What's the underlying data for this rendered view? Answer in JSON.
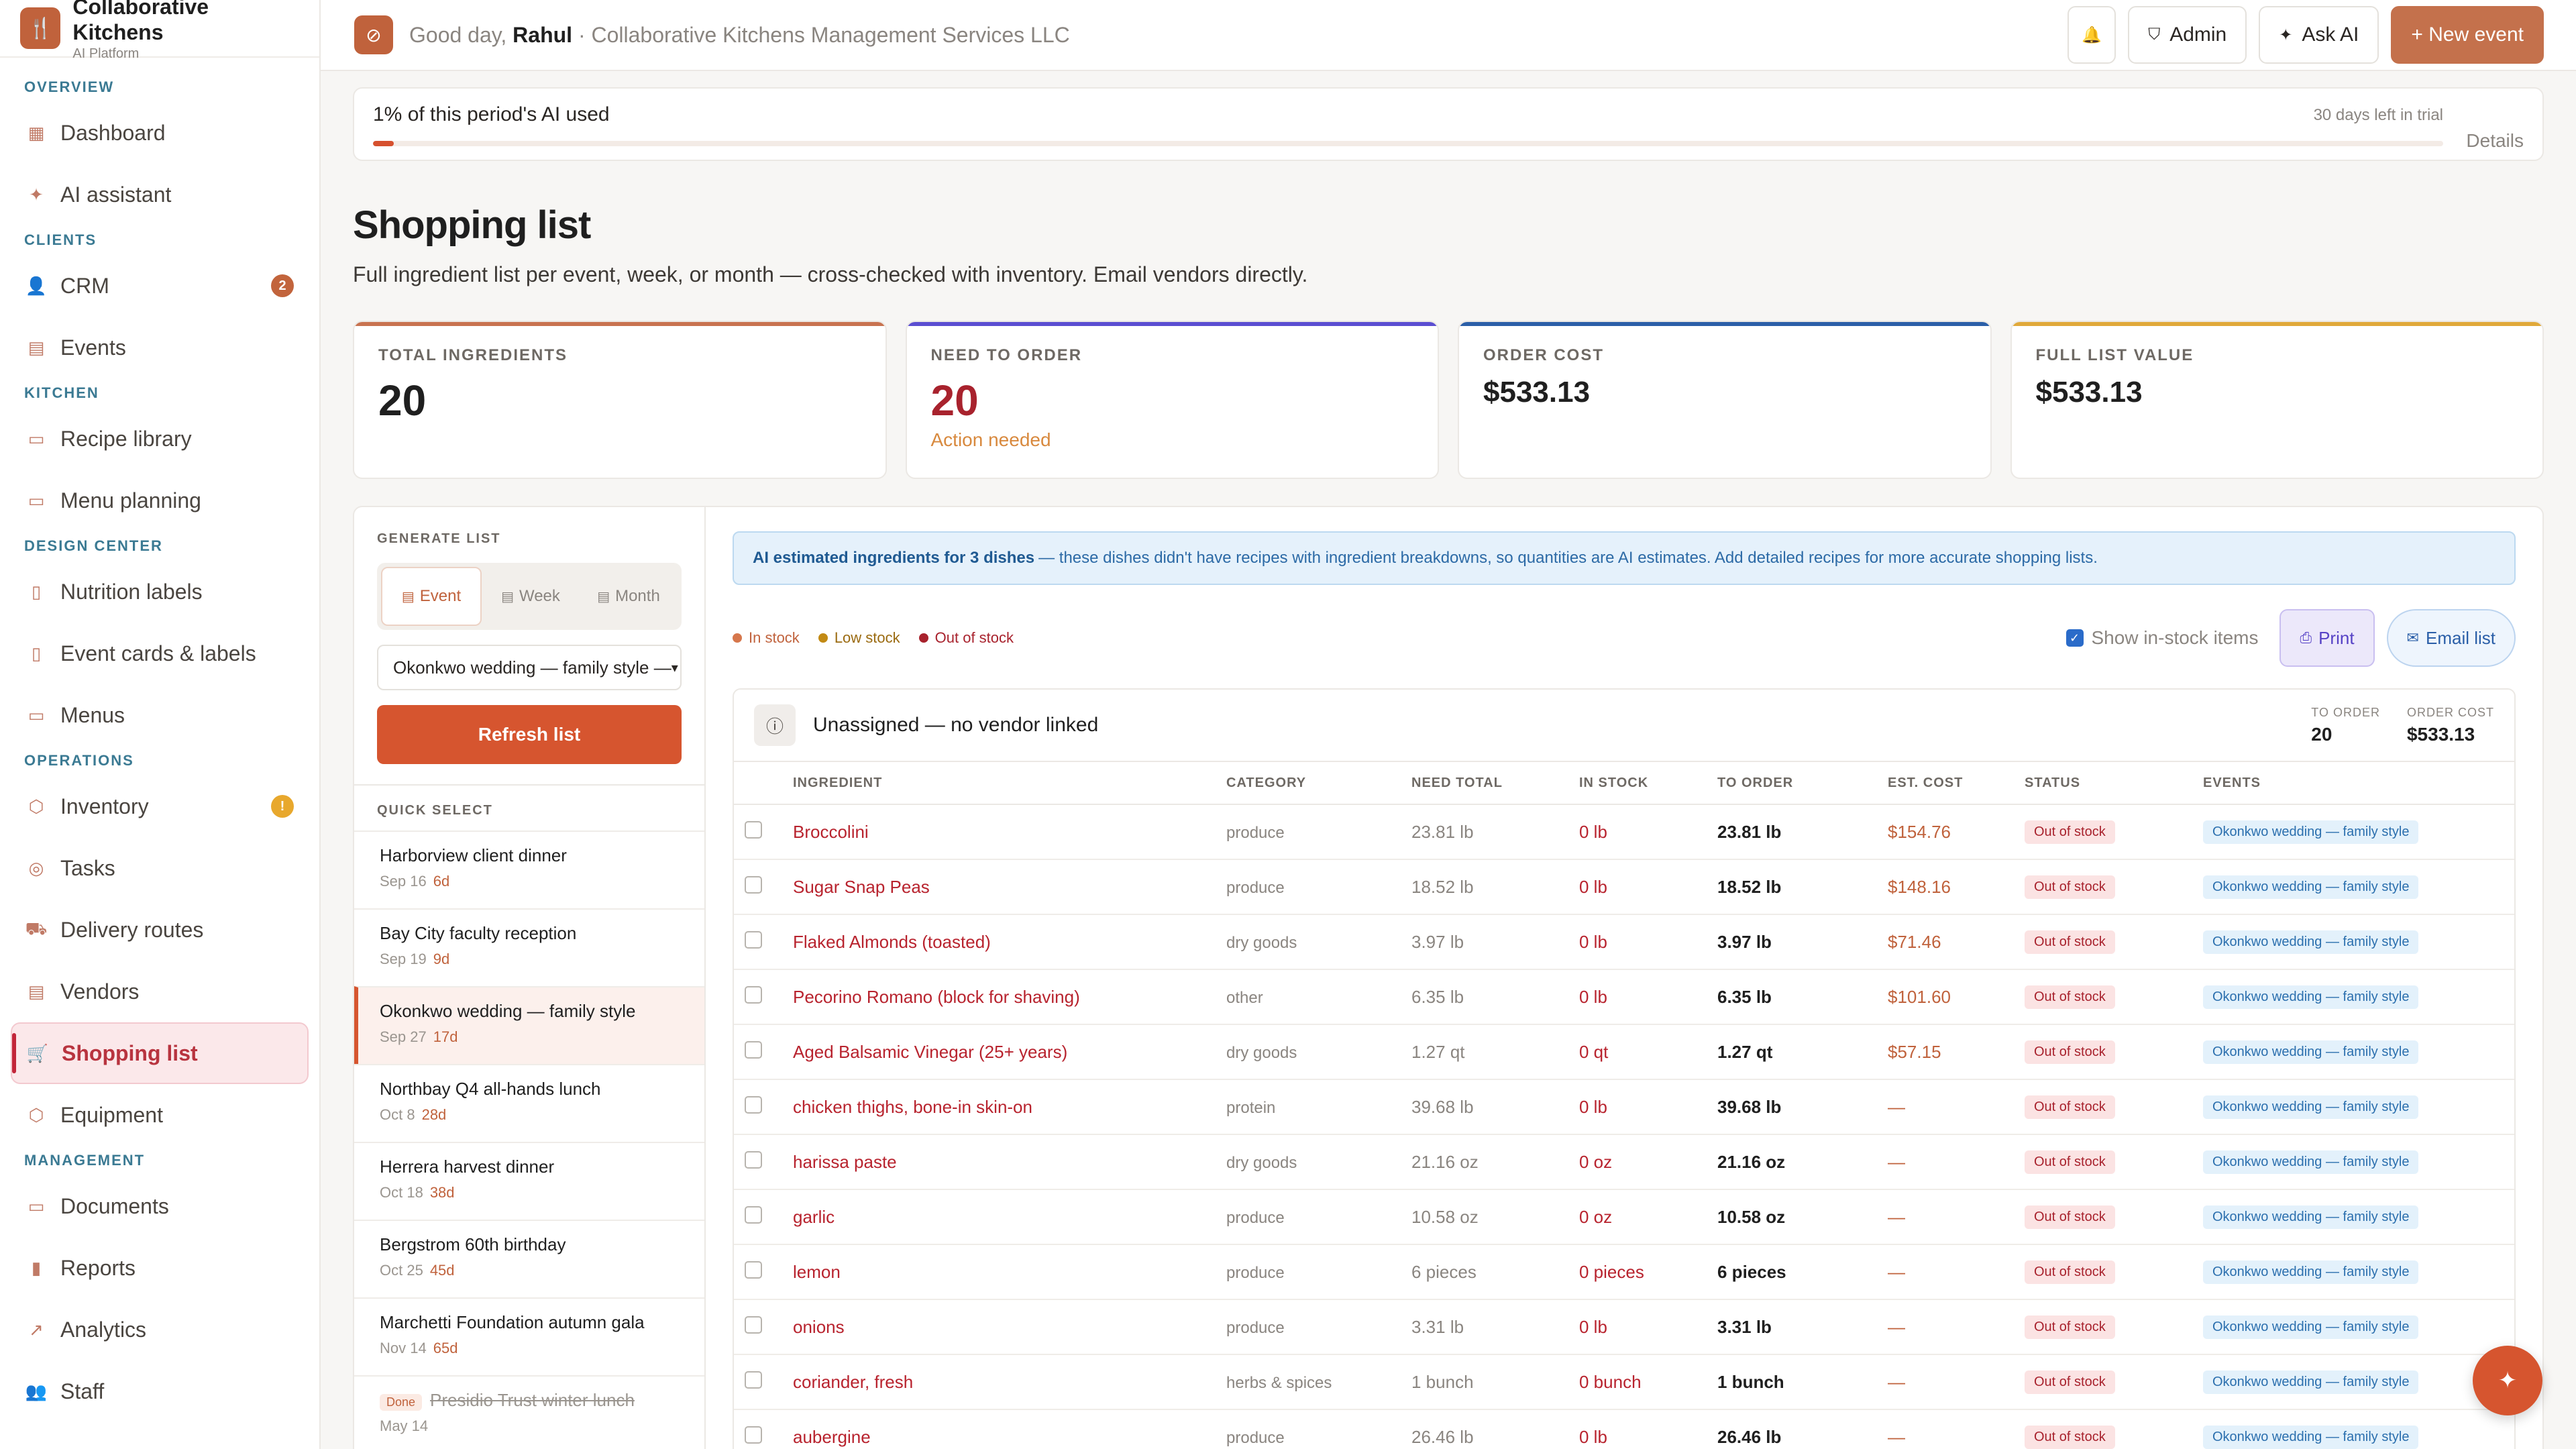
{
  "brand": {
    "name": "Collaborative Kitchens",
    "sub": "AI Platform"
  },
  "nav": {
    "overview": "OVERVIEW",
    "dashboard": "Dashboard",
    "ai_assistant": "AI assistant",
    "clients": "CLIENTS",
    "crm": "CRM",
    "crm_badge": "2",
    "events": "Events",
    "kitchen": "KITCHEN",
    "recipe_library": "Recipe library",
    "menu_planning": "Menu planning",
    "design_center": "DESIGN CENTER",
    "nutrition_labels": "Nutrition labels",
    "event_cards": "Event cards & labels",
    "menus": "Menus",
    "operations": "OPERATIONS",
    "inventory": "Inventory",
    "inventory_badge": "!",
    "tasks": "Tasks",
    "delivery_routes": "Delivery routes",
    "vendors": "Vendors",
    "shopping_list": "Shopping list",
    "equipment": "Equipment",
    "management": "MANAGEMENT",
    "documents": "Documents",
    "reports": "Reports",
    "analytics": "Analytics",
    "staff": "Staff"
  },
  "topbar": {
    "greeting": "Good day,",
    "user": "Rahul",
    "company": "· Collaborative Kitchens Management Services LLC",
    "admin": "Admin",
    "ask_ai": "Ask AI",
    "new_event": "+ New event"
  },
  "usage": {
    "title": "1% of this period's AI used",
    "trial": "30 days left in trial",
    "details": "Details",
    "percent": 1
  },
  "page": {
    "title": "Shopping list",
    "subtitle": "Full ingredient list per event, week, or month — cross-checked with inventory. Email vendors directly."
  },
  "stats": {
    "total_label": "TOTAL INGREDIENTS",
    "total_value": "20",
    "need_label": "NEED TO ORDER",
    "need_value": "20",
    "need_note": "Action needed",
    "cost_label": "ORDER COST",
    "cost_value": "$533.13",
    "full_label": "FULL LIST VALUE",
    "full_value": "$533.13"
  },
  "generate": {
    "label": "GENERATE LIST",
    "event": "Event",
    "week": "Week",
    "month": "Month",
    "selected": "Okonkwo wedding — family style —",
    "refresh": "Refresh list"
  },
  "quick_select": {
    "label": "QUICK SELECT",
    "items": [
      {
        "name": "Harborview client dinner",
        "date": "Sep 16",
        "rel": "6d"
      },
      {
        "name": "Bay City faculty reception",
        "date": "Sep 19",
        "rel": "9d"
      },
      {
        "name": "Okonkwo wedding — family style",
        "date": "Sep 27",
        "rel": "17d"
      },
      {
        "name": "Northbay Q4 all-hands lunch",
        "date": "Oct 8",
        "rel": "28d"
      },
      {
        "name": "Herrera harvest dinner",
        "date": "Oct 18",
        "rel": "38d"
      },
      {
        "name": "Bergstrom 60th birthday",
        "date": "Oct 25",
        "rel": "45d"
      },
      {
        "name": "Marchetti Foundation autumn gala",
        "date": "Nov 14",
        "rel": "65d"
      }
    ],
    "done_tag": "Done",
    "done_name": "Presidio Trust winter lunch",
    "done_date": "May 14"
  },
  "banner": {
    "bold": "AI estimated ingredients for 3 dishes",
    "text": "— these dishes didn't have recipes with ingredient breakdowns, so quantities are AI estimates. Add detailed recipes for more accurate shopping lists."
  },
  "legend": {
    "in": "In stock",
    "low": "Low stock",
    "out": "Out of stock"
  },
  "actions": {
    "show_in_stock": "Show in-stock items",
    "print": "Print",
    "email": "Email list"
  },
  "vendor": {
    "title": "Unassigned — no vendor linked",
    "to_order_label": "TO ORDER",
    "to_order_value": "20",
    "cost_label": "ORDER COST",
    "cost_value": "$533.13"
  },
  "table": {
    "headers": [
      "INGREDIENT",
      "CATEGORY",
      "NEED TOTAL",
      "IN STOCK",
      "TO ORDER",
      "EST. COST",
      "STATUS",
      "EVENTS"
    ],
    "rows": [
      [
        "Broccolini",
        "produce",
        "23.81 lb",
        "0 lb",
        "23.81 lb",
        "$154.76",
        "Out of stock",
        "Okonkwo wedding — family style"
      ],
      [
        "Sugar Snap Peas",
        "produce",
        "18.52 lb",
        "0 lb",
        "18.52 lb",
        "$148.16",
        "Out of stock",
        "Okonkwo wedding — family style"
      ],
      [
        "Flaked Almonds (toasted)",
        "dry goods",
        "3.97 lb",
        "0 lb",
        "3.97 lb",
        "$71.46",
        "Out of stock",
        "Okonkwo wedding — family style"
      ],
      [
        "Pecorino Romano (block for shaving)",
        "other",
        "6.35 lb",
        "0 lb",
        "6.35 lb",
        "$101.60",
        "Out of stock",
        "Okonkwo wedding — family style"
      ],
      [
        "Aged Balsamic Vinegar (25+ years)",
        "dry goods",
        "1.27 qt",
        "0 qt",
        "1.27 qt",
        "$57.15",
        "Out of stock",
        "Okonkwo wedding — family style"
      ],
      [
        "chicken thighs, bone-in skin-on",
        "protein",
        "39.68 lb",
        "0 lb",
        "39.68 lb",
        "—",
        "Out of stock",
        "Okonkwo wedding — family style"
      ],
      [
        "harissa paste",
        "dry goods",
        "21.16 oz",
        "0 oz",
        "21.16 oz",
        "—",
        "Out of stock",
        "Okonkwo wedding — family style"
      ],
      [
        "garlic",
        "produce",
        "10.58 oz",
        "0 oz",
        "10.58 oz",
        "—",
        "Out of stock",
        "Okonkwo wedding — family style"
      ],
      [
        "lemon",
        "produce",
        "6 pieces",
        "0 pieces",
        "6 pieces",
        "—",
        "Out of stock",
        "Okonkwo wedding — family style"
      ],
      [
        "onions",
        "produce",
        "3.31 lb",
        "0 lb",
        "3.31 lb",
        "—",
        "Out of stock",
        "Okonkwo wedding — family style"
      ],
      [
        "coriander, fresh",
        "herbs & spices",
        "1 bunch",
        "0 bunch",
        "1 bunch",
        "—",
        "Out of stock",
        "Okonkwo wedding — family style"
      ],
      [
        "aubergine",
        "produce",
        "26.46 lb",
        "0 lb",
        "26.46 lb",
        "—",
        "Out of stock",
        "Okonkwo wedding — family style"
      ]
    ]
  }
}
